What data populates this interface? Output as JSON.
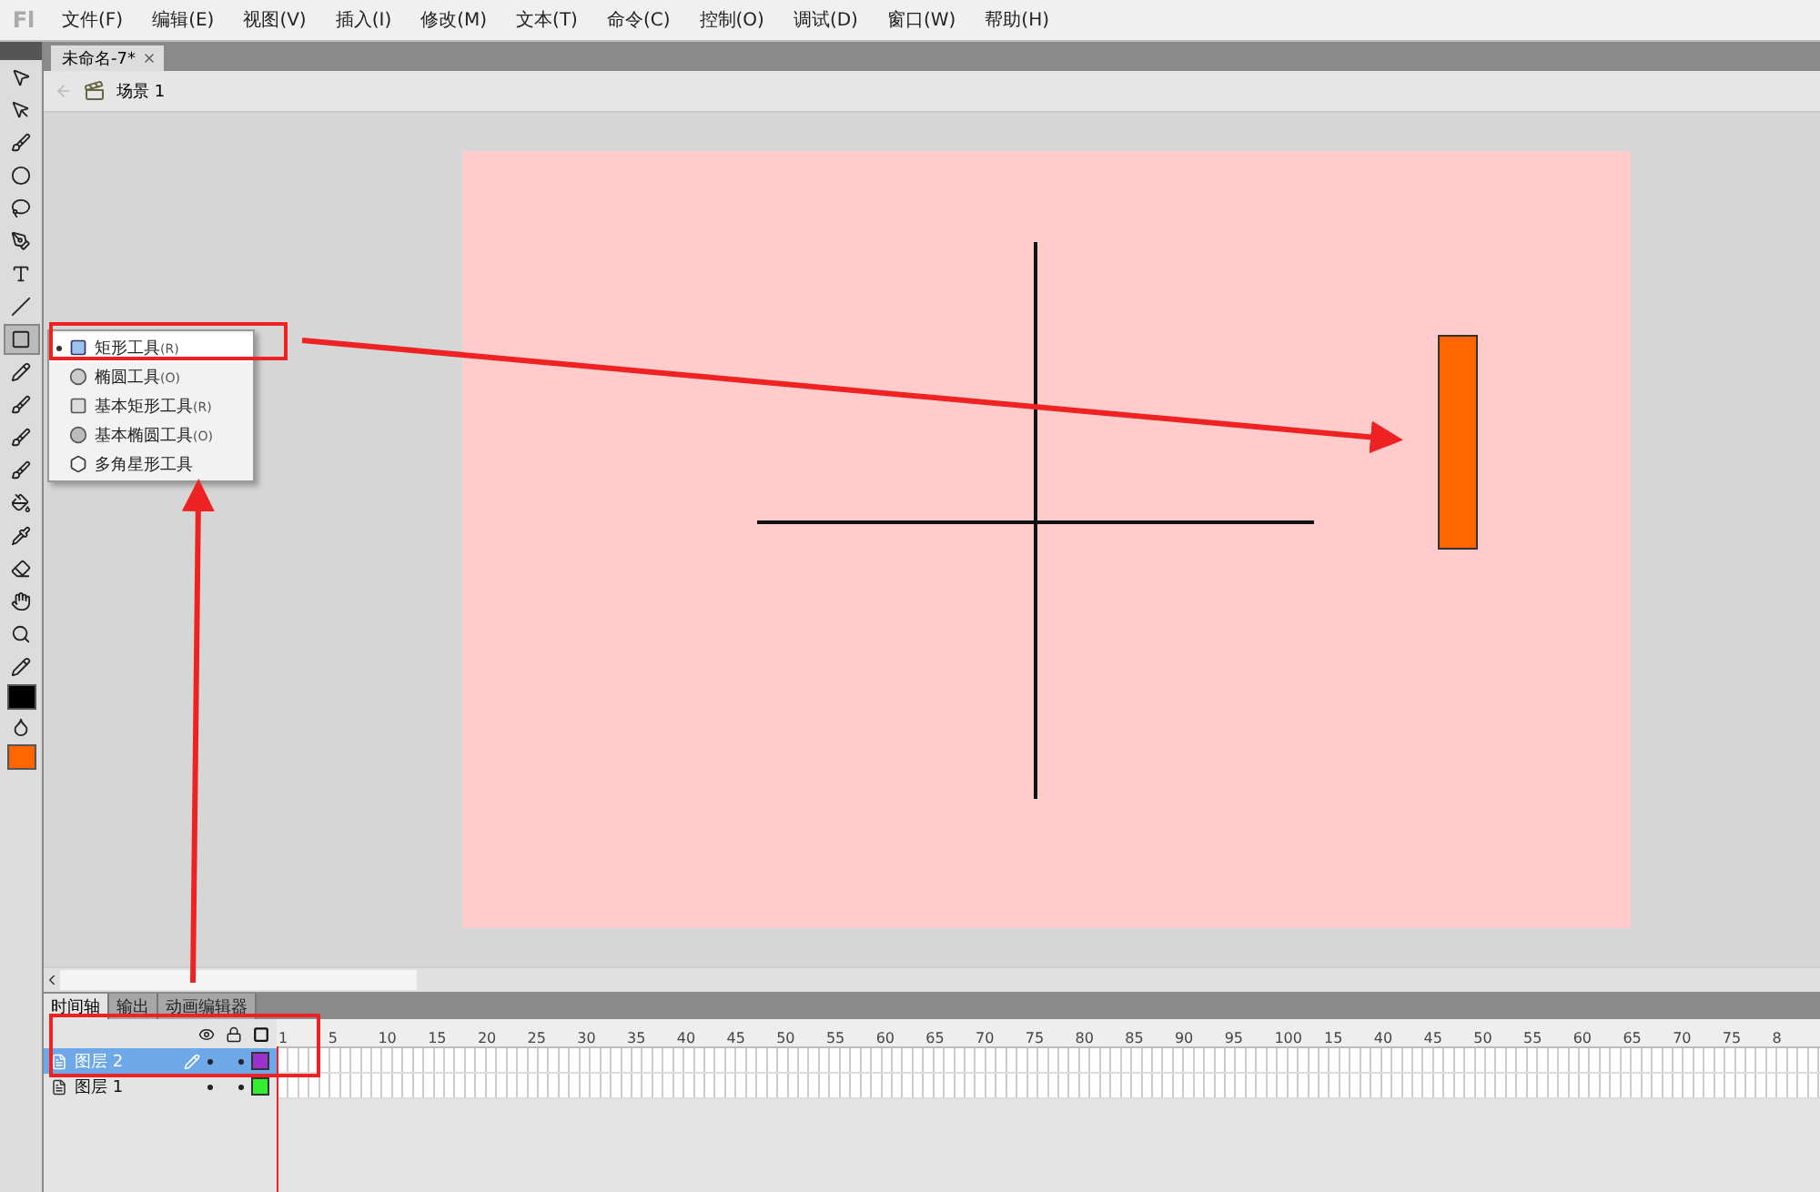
{
  "app_logo": "Fl",
  "menu": [
    "文件(F)",
    "编辑(E)",
    "视图(V)",
    "插入(I)",
    "修改(M)",
    "文本(T)",
    "命令(C)",
    "控制(O)",
    "调试(D)",
    "窗口(W)",
    "帮助(H)"
  ],
  "document_tab": {
    "title": "未命名-7*"
  },
  "breadcrumb": {
    "scene": "场景 1"
  },
  "flyout_menu": {
    "items": [
      {
        "kind": "rect",
        "label": "矩形工具",
        "shortcut": "(R)",
        "selected": true
      },
      {
        "kind": "oval",
        "label": "椭圆工具",
        "shortcut": "(O)",
        "selected": false
      },
      {
        "kind": "prim-rect",
        "label": "基本矩形工具",
        "shortcut": "(R)",
        "selected": false
      },
      {
        "kind": "prim-oval",
        "label": "基本椭圆工具",
        "shortcut": "(O)",
        "selected": false
      },
      {
        "kind": "polystar",
        "label": "多角星形工具",
        "selected": false
      }
    ]
  },
  "timeline": {
    "tabs": [
      {
        "label": "时间轴",
        "selected": true
      },
      {
        "label": "输出",
        "selected": false
      },
      {
        "label": "动画编辑器",
        "selected": false
      }
    ],
    "ruler": [
      "1",
      "5",
      "10",
      "15",
      "20",
      "25",
      "30",
      "35",
      "40",
      "45",
      "50",
      "55",
      "60",
      "65",
      "70",
      "75",
      "80",
      "85",
      "90",
      "95",
      "100",
      "15",
      "40",
      "45",
      "50",
      "55",
      "60",
      "65",
      "70",
      "75",
      "8"
    ],
    "layers": [
      {
        "name": "图层 2",
        "selected": true,
        "editing": true,
        "color": "#9933cc"
      },
      {
        "name": "图层 1",
        "selected": false,
        "editing": false,
        "color": "#33ee33"
      }
    ]
  }
}
